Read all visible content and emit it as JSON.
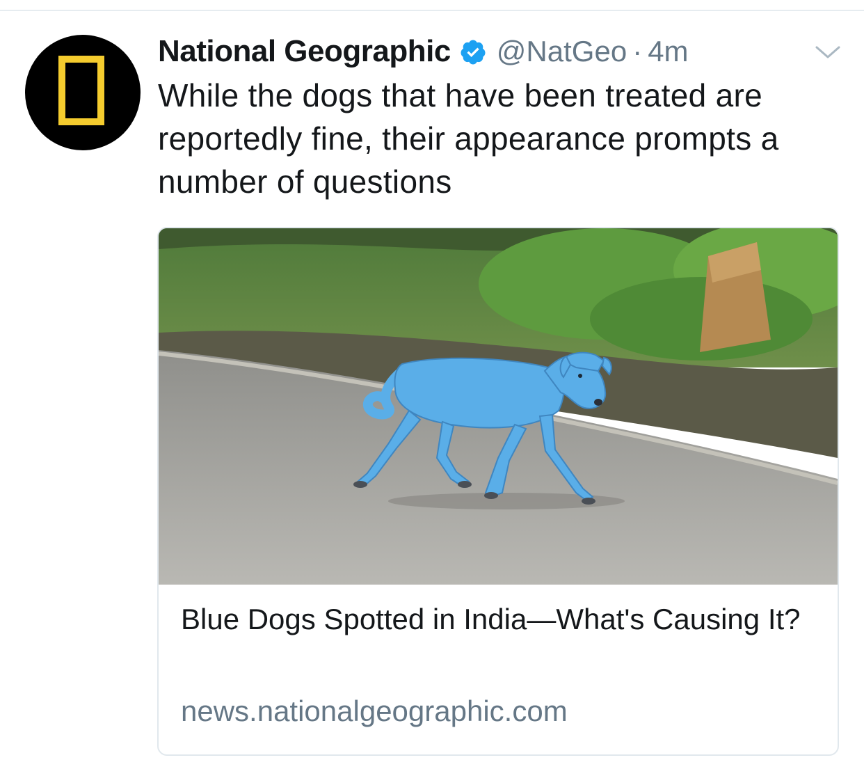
{
  "tweet": {
    "author_name": "National Geographic",
    "verified": true,
    "handle": "@NatGeo",
    "separator": "·",
    "timestamp": "4m",
    "text": "While the dogs that have been treated are reportedly fine, their appearance prompts a number of questions"
  },
  "card": {
    "title": "Blue Dogs Spotted in India—What's Causing It?",
    "domain": "news.nationalgeographic.com"
  },
  "icons": {
    "verified": "verified-badge-icon",
    "caret": "chevron-down-icon"
  },
  "colors": {
    "verified_blue": "#1da1f2",
    "secondary_text": "#657786",
    "logo_yellow": "#f5cc2e",
    "dog_blue": "#5aaee8"
  }
}
